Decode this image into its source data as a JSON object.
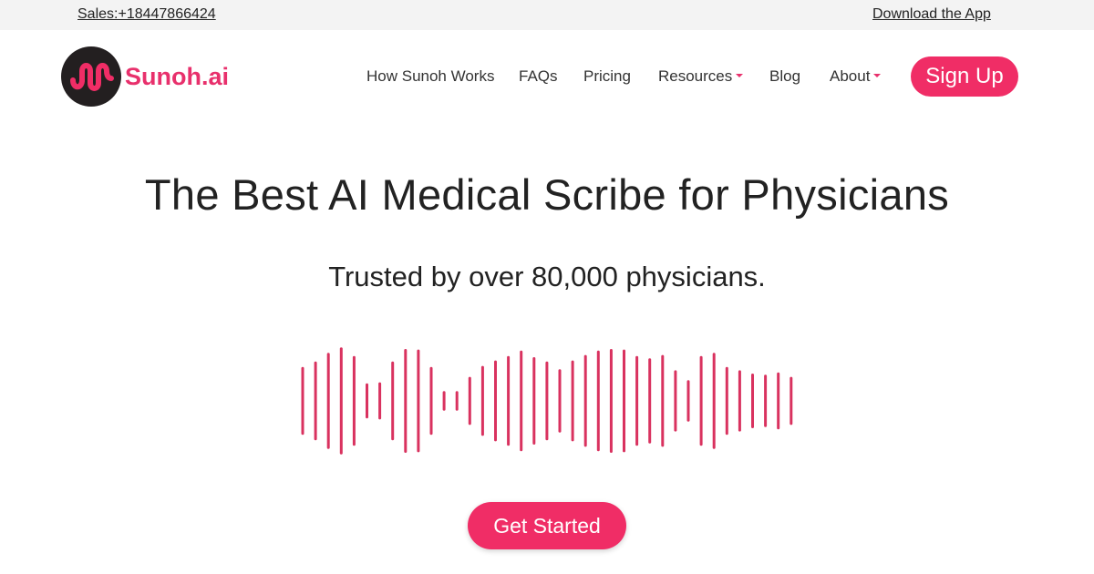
{
  "topbar": {
    "sales_label": "Sales:+18447866424",
    "app_label": "Download the App"
  },
  "brand": {
    "name": "Sunoh.ai",
    "accent_color": "#f02d66",
    "badge_color": "#231f20",
    "logo_icon": "waveform-squiggle-icon"
  },
  "nav": {
    "items": [
      {
        "label": "How Sunoh Works",
        "has_dropdown": false
      },
      {
        "label": "FAQs",
        "has_dropdown": false
      },
      {
        "label": "Pricing",
        "has_dropdown": false
      },
      {
        "label": "Resources",
        "has_dropdown": true
      },
      {
        "label": "Blog",
        "has_dropdown": false
      },
      {
        "label": "About",
        "has_dropdown": true
      }
    ],
    "signup_label": "Sign Up"
  },
  "hero": {
    "headline": "The Best AI Medical Scribe for Physicians",
    "subheadline": "Trusted by over 80,000 physicians.",
    "waveform_color": "#d9325f",
    "waveform_levels": [
      0.62,
      0.72,
      0.88,
      0.98,
      0.82,
      0.32,
      0.34,
      0.72,
      0.95,
      0.94,
      0.62,
      0.18,
      0.18,
      0.44,
      0.64,
      0.74,
      0.82,
      0.92,
      0.8,
      0.72,
      0.58,
      0.74,
      0.84,
      0.92,
      0.95,
      0.94,
      0.82,
      0.78,
      0.84,
      0.56,
      0.38,
      0.82,
      0.88,
      0.62,
      0.56,
      0.5,
      0.48,
      0.52,
      0.44,
      0.2,
      0.22
    ],
    "cta_label": "Get Started"
  }
}
